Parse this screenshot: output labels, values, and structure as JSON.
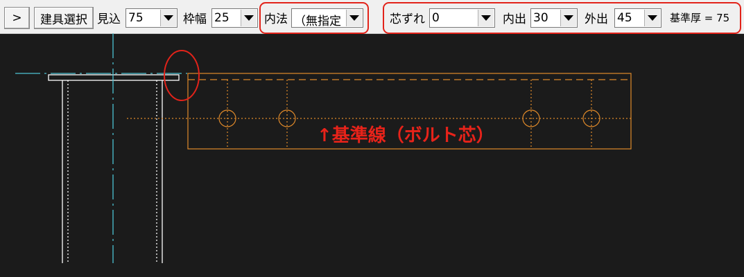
{
  "toolbar": {
    "expand_button": ">",
    "select_button": "建具選択",
    "mikomi_label": "見込",
    "mikomi_value": "75",
    "wakuhaba_label": "枠幅",
    "wakuhaba_value": "25",
    "uchinori_label": "内法",
    "uchinori_value": "（無指定",
    "shinzure_label": "芯ずれ",
    "shinzure_value": "0",
    "uchide_label": "内出",
    "uchide_value": "30",
    "sotode_label": "外出",
    "sotode_value": "45",
    "kijun_text": "基準厚 = 75"
  },
  "drawing": {
    "annotation": "↑基準線（ボルト芯）",
    "colors": {
      "background": "#1b1b1b",
      "frame": "#ffffff",
      "centerline": "#4cc3d4",
      "plate": "#e08a2a",
      "highlight": "#e2231a"
    }
  }
}
